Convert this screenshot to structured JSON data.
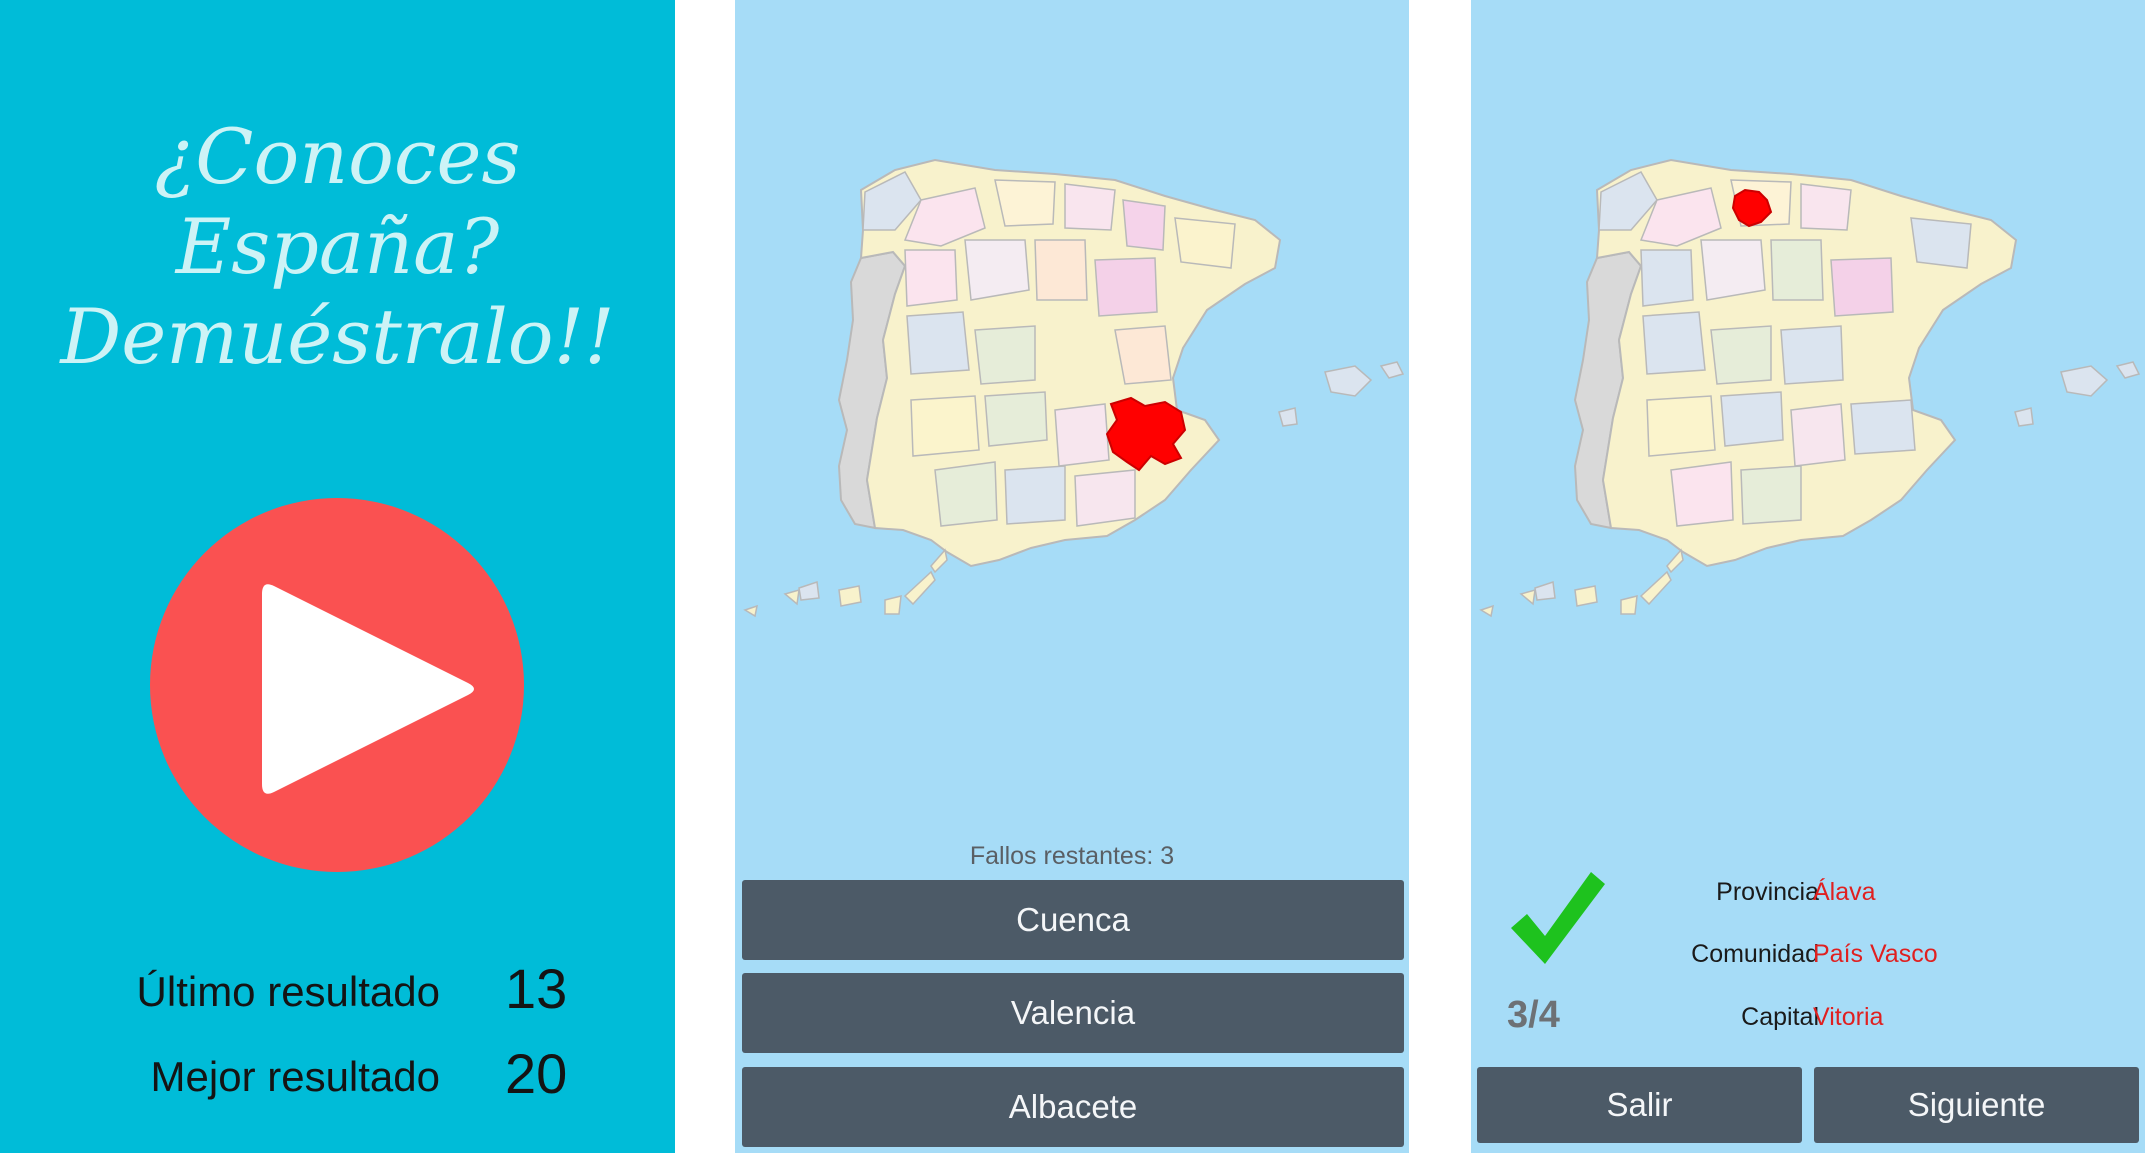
{
  "home": {
    "title_lines": [
      "¿Conoces",
      "España?",
      "Demuéstralo!!"
    ],
    "last_result_label": "Último resultado",
    "last_result_value": "13",
    "best_result_label": "Mejor resultado",
    "best_result_value": "20",
    "play_icon": "play-icon"
  },
  "quiz": {
    "remaining_errors": "Fallos restantes: 3",
    "options": [
      "Cuenca",
      "Valencia",
      "Albacete"
    ],
    "highlighted_region_color": "#ff0000"
  },
  "result": {
    "province_label": "Provincia",
    "province_value": "Álava",
    "community_label": "Comunidad",
    "community_value": "País Vasco",
    "capital_label": "Capital",
    "capital_value": "Vitoria",
    "progress": "3/4",
    "exit_label": "Salir",
    "next_label": "Siguiente",
    "check_icon": "check-icon"
  },
  "colors": {
    "home_bg": "#00bcd8",
    "play_button": "#fa5151",
    "sea": "#a6dcf7",
    "button": "#4c5a67",
    "highlight": "#ff0000",
    "value_text": "#e02020",
    "check": "#1ec21e"
  }
}
